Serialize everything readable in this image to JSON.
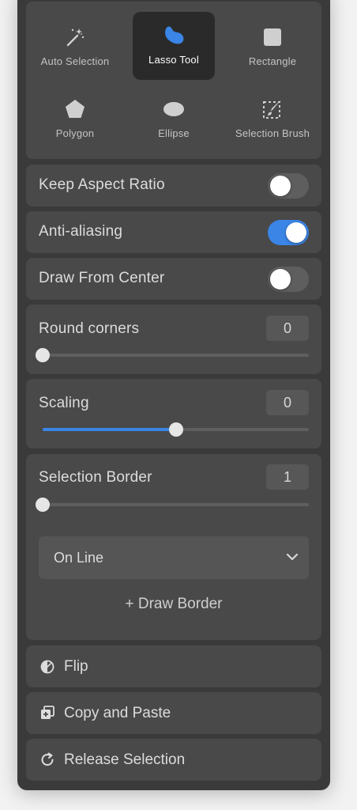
{
  "tools": [
    {
      "label": "Auto Selection",
      "icon": "magic-wand-icon",
      "active": false
    },
    {
      "label": "Lasso Tool",
      "icon": "lasso-blob-icon",
      "active": true
    },
    {
      "label": "Rectangle",
      "icon": "square-icon",
      "active": false
    },
    {
      "label": "Polygon",
      "icon": "pentagon-icon",
      "active": false
    },
    {
      "label": "Ellipse",
      "icon": "ellipse-icon",
      "active": false
    },
    {
      "label": "Selection Brush",
      "icon": "selection-brush-icon",
      "active": false
    }
  ],
  "toggles": {
    "keep_aspect_ratio": {
      "label": "Keep Aspect Ratio",
      "on": false
    },
    "anti_aliasing": {
      "label": "Anti-aliasing",
      "on": true
    },
    "draw_from_center": {
      "label": "Draw From Center",
      "on": false
    }
  },
  "sliders": {
    "round_corners": {
      "label": "Round corners",
      "value": "0",
      "fraction": 0.0
    },
    "scaling": {
      "label": "Scaling",
      "value": "0",
      "fraction": 0.5
    },
    "selection_border": {
      "label": "Selection Border",
      "value": "1",
      "fraction": 0.0
    }
  },
  "border_mode": {
    "selected": "On Line"
  },
  "draw_border": {
    "label": "+ Draw Border"
  },
  "actions": {
    "flip": {
      "label": "Flip",
      "icon": "half-circle-icon"
    },
    "copy_paste": {
      "label": "Copy and Paste",
      "icon": "copy-plus-icon"
    },
    "release": {
      "label": "Release Selection",
      "icon": "refresh-icon"
    }
  },
  "colors": {
    "accent": "#3a85e6",
    "panel": "#3a3a3a",
    "card": "#494949"
  }
}
